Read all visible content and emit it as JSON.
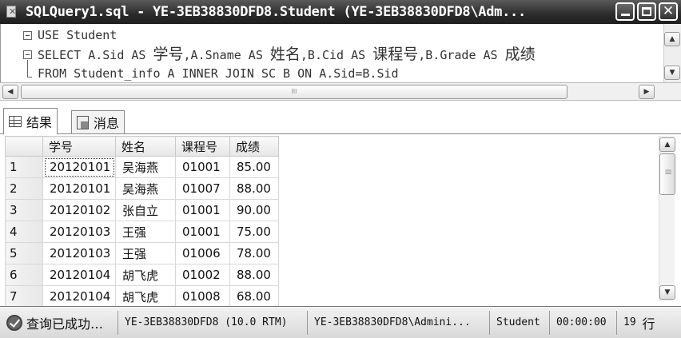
{
  "window": {
    "title": "SQLQuery1.sql - YE-3EB38830DFD8.Student (YE-3EB38830DFD8\\Adm...",
    "close_glyph": "✕"
  },
  "editor": {
    "lines": [
      {
        "code": "USE Student"
      },
      {
        "parts": [
          "SELECT A.Sid AS ",
          "学号",
          ",A.Sname AS ",
          "姓名",
          ",B.Cid AS ",
          "课程号",
          ",B.Grade AS ",
          "成绩"
        ]
      },
      {
        "code": "FROM Student_info A INNER JOIN SC B ON A.Sid=B.Sid"
      }
    ]
  },
  "hscroll": {
    "thumb_grip": "III",
    "left_arrow": "◀",
    "right_arrow": "▶"
  },
  "tabs": [
    {
      "label": "结果",
      "icon": "grid-icon"
    },
    {
      "label": "消息",
      "icon": "message-icon"
    }
  ],
  "results": {
    "columns": [
      "学号",
      "姓名",
      "课程号",
      "成绩"
    ],
    "rows": [
      [
        "1",
        "20120101",
        "吴海燕",
        "01001",
        "85.00"
      ],
      [
        "2",
        "20120101",
        "吴海燕",
        "01007",
        "88.00"
      ],
      [
        "3",
        "20120102",
        "张自立",
        "01001",
        "90.00"
      ],
      [
        "4",
        "20120103",
        "王强",
        "01001",
        "75.00"
      ],
      [
        "5",
        "20120103",
        "王强",
        "01006",
        "78.00"
      ],
      [
        "6",
        "20120104",
        "胡飞虎",
        "01002",
        "88.00"
      ],
      [
        "7",
        "20120104",
        "胡飞虎",
        "01008",
        "68.00"
      ]
    ]
  },
  "status": {
    "message": "查询已成功…",
    "server": "YE-3EB38830DFD8 (10.0 RTM)",
    "user": "YE-3EB38830DFD8\\Admini...",
    "database": "Student",
    "elapsed": "00:00:00",
    "rows_num": "19",
    "rows_unit": "行"
  }
}
